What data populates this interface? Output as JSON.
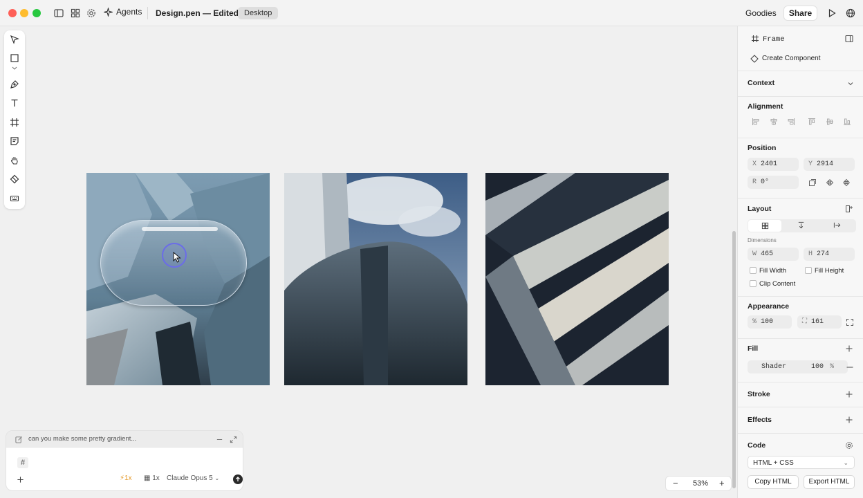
{
  "topbar": {
    "agents_label": "Agents",
    "doc_title": "Design.pen — Edited",
    "device_badge": "Desktop",
    "goodies_label": "Goodies",
    "share_label": "Share"
  },
  "colors": {
    "close": "#fe5f57",
    "minimize": "#febc2e",
    "zoom": "#28c840",
    "selection": "#6b6ce8"
  },
  "toolbar": {
    "tools": [
      "move-icon",
      "rectangle-icon",
      "pen-icon",
      "text-icon",
      "frame-icon",
      "note-icon",
      "hand-icon",
      "component-icon",
      "keyboard-icon"
    ]
  },
  "chat": {
    "prompt_preview": "can you make some pretty gradient...",
    "attachment_icon": "#",
    "speed_label": "1x",
    "count_label": "1x",
    "model_label": "Claude Opus 5"
  },
  "zoom": {
    "level": "53%"
  },
  "panel": {
    "frame_label": "Frame",
    "create_component_label": "Create Component",
    "context_label": "Context",
    "alignment_label": "Alignment",
    "position_label": "Position",
    "x_label": "X",
    "x_value": "2401",
    "y_label": "Y",
    "y_value": "2914",
    "r_label": "R",
    "r_value": "0°",
    "layout_label": "Layout",
    "dimensions_label": "Dimensions",
    "w_label": "W",
    "w_value": "465",
    "h_label": "H",
    "h_value": "274",
    "fill_width_label": "Fill Width",
    "fill_height_label": "Fill Height",
    "clip_content_label": "Clip Content",
    "appearance_label": "Appearance",
    "opacity_label": "%",
    "opacity_value": "100",
    "radius_value": "161",
    "fill_label": "Fill",
    "fill_type": "Shader",
    "fill_opacity": "100",
    "fill_percent": "%",
    "stroke_label": "Stroke",
    "effects_label": "Effects",
    "code_label": "Code",
    "code_format": "HTML + CSS",
    "copy_html_label": "Copy HTML",
    "export_html_label": "Export HTML"
  }
}
